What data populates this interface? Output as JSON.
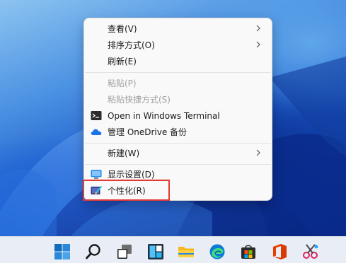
{
  "colors": {
    "menu_bg": "#f9f9f9",
    "text": "#1a1a1a",
    "disabled_text": "#a0a0a0",
    "highlight_border": "#e53935",
    "taskbar_bg": "#e9eef6"
  },
  "context_menu": {
    "items": [
      {
        "label": "查看(V)",
        "submenu": true,
        "enabled": true,
        "icon": null
      },
      {
        "label": "排序方式(O)",
        "submenu": true,
        "enabled": true,
        "icon": null
      },
      {
        "label": "刷新(E)",
        "submenu": false,
        "enabled": true,
        "icon": null
      },
      {
        "label": "粘贴(P)",
        "submenu": false,
        "enabled": false,
        "icon": null
      },
      {
        "label": "粘贴快捷方式(S)",
        "submenu": false,
        "enabled": false,
        "icon": null
      },
      {
        "label": "Open in Windows Terminal",
        "submenu": false,
        "enabled": true,
        "icon": "terminal-icon"
      },
      {
        "label": "管理 OneDrive 备份",
        "submenu": false,
        "enabled": true,
        "icon": "onedrive-cloud-icon"
      },
      {
        "label": "新建(W)",
        "submenu": true,
        "enabled": true,
        "icon": null
      },
      {
        "label": "显示设置(D)",
        "submenu": false,
        "enabled": true,
        "icon": "display-settings-icon"
      },
      {
        "label": "个性化(R)",
        "submenu": false,
        "enabled": true,
        "icon": "personalize-icon",
        "highlighted": true
      }
    ]
  },
  "taskbar": {
    "icons": [
      "windows-start-icon",
      "search-icon",
      "task-view-icon",
      "widgets-icon",
      "file-explorer-icon",
      "edge-browser-icon",
      "microsoft-store-icon",
      "office-icon",
      "snipping-tool-icon"
    ]
  }
}
